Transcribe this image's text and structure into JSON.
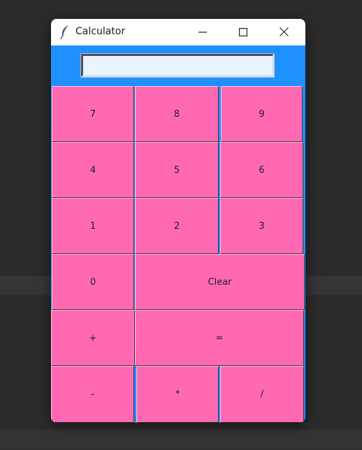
{
  "window": {
    "title": "Calculator",
    "accent_color": "#1e90ff",
    "button_color": "#ff69b4",
    "display_value": ""
  },
  "titlebar_icons": {
    "app": "feather-icon",
    "minimize": "minimize-icon",
    "maximize": "maximize-icon",
    "close": "close-icon"
  },
  "keys": {
    "k7": "7",
    "k8": "8",
    "k9": "9",
    "k4": "4",
    "k5": "5",
    "k6": "6",
    "k1": "1",
    "k2": "2",
    "k3": "3",
    "k0": "0",
    "clear": "Clear",
    "plus": "+",
    "equals": "=",
    "minus": "-",
    "multiply": "*",
    "divide": "/"
  }
}
